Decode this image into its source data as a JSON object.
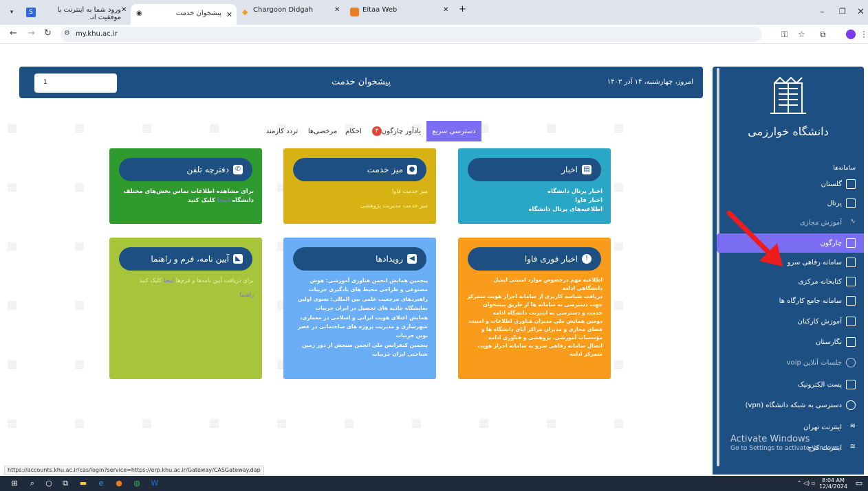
{
  "browser": {
    "tabs": [
      {
        "label": "ورود شما به اینترنت با موفقیت انـ",
        "active": false
      },
      {
        "label": "پیشخوان خدمت",
        "active": true
      },
      {
        "label": "Chargoon Didgah",
        "active": false
      },
      {
        "label": "Eitaa Web",
        "active": false
      }
    ],
    "url": "my.khu.ac.ir",
    "status_url": "https://accounts.khu.ac.ir/cas/login?service=https://erp.khu.ac.ir/Gateway/CASGateway.dap"
  },
  "header": {
    "title": "پیشخوان خدمت",
    "date": "امروز، چهارشنبه، ۱۴ آذر ۱۴۰۳",
    "user_initial": "1"
  },
  "tabs": [
    {
      "label": "دسترسی سریع",
      "active": true
    },
    {
      "label": "یادآور چارگون",
      "badge": "۳"
    },
    {
      "label": "احکام"
    },
    {
      "label": "مرخصی‌ها"
    },
    {
      "label": "تردد کارمند"
    }
  ],
  "cards": {
    "news": {
      "title": "اخبار",
      "lines": [
        "اخبار پرتال دانشگاه",
        "اخبار فاوا",
        "اطلاعیه‌های پرتال دانشگاه"
      ],
      "bg": "#2aa7c7"
    },
    "service_desk": {
      "title": "میز خدمت",
      "lines": [
        "میز خدمت فاوا",
        "میز خدمت مدیریت پژوهشی"
      ],
      "bg": "#d7b214"
    },
    "phonebook": {
      "title": "دفترچه تلفن",
      "line1": "برای مشاهده اطلاعات تماس بخش‌های مختلف",
      "line2_pre": "دانشگاه",
      "link": "اینجا",
      "line2_post": "کلیک کنید",
      "bg": "#2f9b2f"
    },
    "urgent": {
      "title": "اخبار فوری فاوا",
      "lines": [
        "اطلاعیه مهم درخصوص موارد امنیتی ایمیل",
        "دانشگاهی ادامه",
        "دریافت شناسه کاربری از سامانه احراز هویت متمرکز",
        "جهت دسترسی به سامانه ها از طریق پیشخوان",
        "خدمت و دسترسی به اینترنت دانشگاه ادامه",
        "دومین همایش ملی مدیران فناوری اطلاعات و امنیت",
        "فضای مجازی و مدیران مراکز آپای دانشگاه ها و",
        "مؤسسات آموزشی، پژوهشی و فناوری ادامه",
        "اتصال سامانه رفاهی سرو به سامانه احراز هویت",
        "متمرکز ادامه"
      ],
      "bg": "#f99c1c"
    },
    "events": {
      "title": "رویدادها",
      "lines": [
        "پنجمین همایش انجمن فناوری آموزشی: هوش",
        "مصنوعی و طراحی محیط های یادگیری جزییات",
        "راهبردهای مرجعیت علمی بین المللی: بسوی اولین",
        "نمایشگاه جاذبه های تحصیل در ایران جزییات",
        "همایش اعتلای هویت ایرانی و اسلامی در معماری،",
        "شهرسازی و مدیریت پروژه های ساختمانی در عصر",
        "نوین جزییات",
        "پنجمین کنفرانس ملی انجمن سنجش از دور زمین",
        "شناختی ایران جزییات"
      ],
      "bg": "#6aaef7"
    },
    "regulations": {
      "title": "آیین نامه، فرم و راهنما",
      "line1_pre": "برای دریافت آیین نامه‌ها و فرم‌ها",
      "link": "اینجا",
      "line1_post": "کلیک کنید",
      "line2": "راهنما",
      "bg": "#a8c43a"
    }
  },
  "sidebar": {
    "logo_text": "دانشگاه خوارزمی",
    "section_title": "سامانه‌ها",
    "items": [
      {
        "label": "گلستان"
      },
      {
        "label": "پرتال"
      },
      {
        "label": "آموزش مجازی",
        "muted": true
      },
      {
        "label": "چارگون",
        "active": true
      },
      {
        "label": "سامانه رفاهی سرو"
      },
      {
        "label": "کتابخانه مرکزی"
      },
      {
        "label": "سامانه جامع کارگاه ها"
      },
      {
        "label": "آموزش کارکنان"
      },
      {
        "label": "نگارستان"
      },
      {
        "label": "جلسات آنلاین voip",
        "muted": true
      },
      {
        "label": "پست الکترونیک"
      },
      {
        "label": "دسترسی به شبکه دانشگاه (vpn)"
      },
      {
        "label": "اینترنت تهران"
      },
      {
        "label": "اینترنت کرج"
      }
    ],
    "activate_line1": "Activate Windows",
    "activate_line2": "Go to Settings to activate Windows."
  },
  "taskbar": {
    "time": "8:04 AM",
    "date": "12/4/2024"
  },
  "colors": {
    "primary": "#1d4f82",
    "accent": "#7b6ef2"
  }
}
